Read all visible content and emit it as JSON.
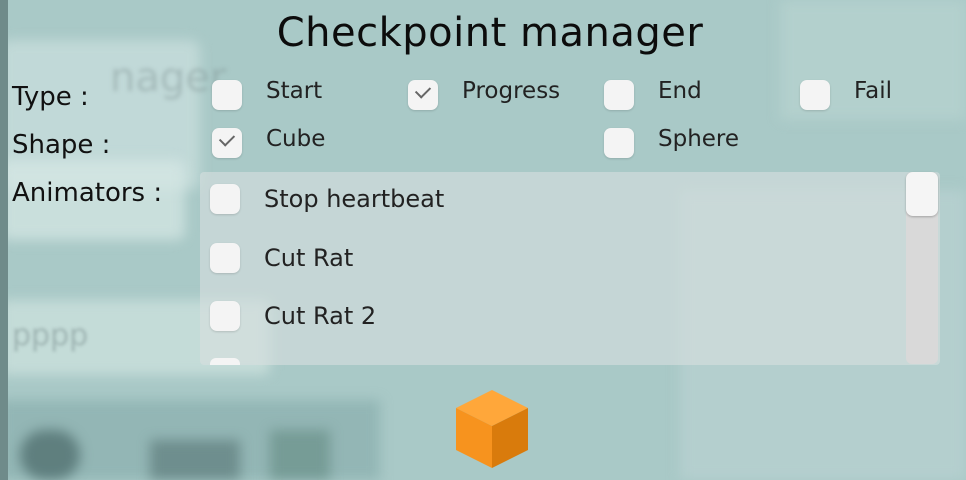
{
  "title": "Checkpoint manager",
  "type_row": {
    "label": "Type :",
    "options": [
      {
        "label": "Start",
        "checked": false
      },
      {
        "label": "Progress",
        "checked": true
      },
      {
        "label": "End",
        "checked": false
      },
      {
        "label": "Fail",
        "checked": false
      }
    ]
  },
  "shape_row": {
    "label": "Shape :",
    "options": [
      {
        "label": "Cube",
        "checked": true
      },
      {
        "label": "Sphere",
        "checked": false
      }
    ]
  },
  "animators": {
    "label": "Animators :",
    "items": [
      {
        "label": "Stop heartbeat",
        "checked": false
      },
      {
        "label": "Cut Rat",
        "checked": false
      },
      {
        "label": "Cut Rat 2",
        "checked": false
      }
    ]
  },
  "background_text": {
    "ghost_title": "nager",
    "ghost_input": "pppp"
  },
  "colors": {
    "cube": "#f7931e",
    "cube_dark": "#d97b0c",
    "cube_light": "#ffa73a"
  },
  "preview_icon": "cube-icon"
}
